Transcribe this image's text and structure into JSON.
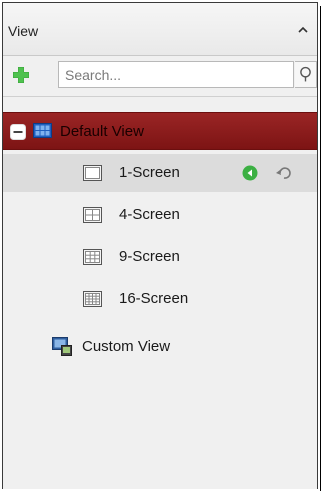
{
  "panel": {
    "title": "View"
  },
  "toolbar": {
    "search_placeholder": "Search..."
  },
  "tree": {
    "default_view": {
      "label": "Default View"
    },
    "items": [
      {
        "label": "1-Screen"
      },
      {
        "label": "4-Screen"
      },
      {
        "label": "9-Screen"
      },
      {
        "label": "16-Screen"
      }
    ],
    "custom_view": {
      "label": "Custom View"
    }
  },
  "colors": {
    "selected_row": "#8b1a1a",
    "add_green": "#3aa33a",
    "play_green": "#3cb043"
  },
  "icons": {
    "collapse": "chevron-up-icon",
    "add": "plus-icon",
    "search": "search-icon",
    "expand_toggle": "minus-box-icon",
    "default_view": "monitor-grid-icon",
    "screen_1": "single-screen-icon",
    "screen_4": "quad-screen-icon",
    "screen_9": "nine-screen-icon",
    "screen_16": "sixteen-screen-icon",
    "start_live": "play-circle-icon",
    "restore": "restore-icon",
    "custom_view": "custom-view-icon"
  }
}
